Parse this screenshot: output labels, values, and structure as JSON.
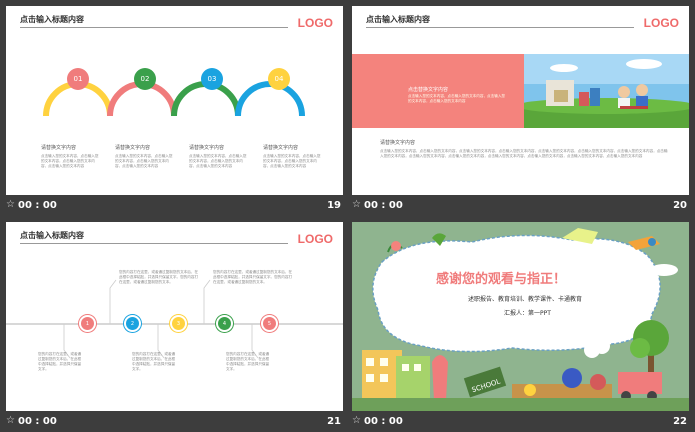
{
  "slides": [
    {
      "title": "点击输入标题内容",
      "logo": "LOGO",
      "steps": [
        {
          "num": "01",
          "color": "#f07c7c",
          "arc": "#ffd23f",
          "heading": "请替换文字内容",
          "text": "点击输入您的文本内容，点击输入您的文本内容，点击输入您的文本内容，点击输入您的文本内容"
        },
        {
          "num": "02",
          "color": "#3aa04b",
          "arc": "#f07c7c",
          "heading": "请替换文字内容",
          "text": "点击输入您的文本内容，点击输入您的文本内容，点击输入您的文本内容，点击输入您的文本内容"
        },
        {
          "num": "03",
          "color": "#1aa3e0",
          "arc": "#3aa04b",
          "heading": "请替换文字内容",
          "text": "点击输入您的文本内容，点击输入您的文本内容，点击输入您的文本内容，点击输入您的文本内容"
        },
        {
          "num": "04",
          "color": "#ffd23f",
          "arc": "#1aa3e0",
          "heading": "请替换文字内容",
          "text": "点击输入您的文本内容，点击输入您的文本内容，点击输入您的文本内容，点击输入您的文本内容"
        }
      ],
      "footer": {
        "time": "00 : 00",
        "num": "19"
      }
    },
    {
      "title": "点击输入标题内容",
      "logo": "LOGO",
      "banner_heading": "点击替换文字内容",
      "banner_text": "点击输入您的文本内容，点击输入您的文本内容，点击输入您的文本内容，点击输入您的文本内容",
      "body_heading": "请替换文字内容",
      "body_text": "点击输入您的文本内容，点击输入您的文本内容，点击输入您的文本内容，点击输入您的文本内容，点击输入您的文本内容，点击输入您的文本内容，点击输入您的文本内容，点击输入您的文本内容，点击输入您的文本内容，点击输入您的文本内容，点击输入您的文本内容，点击输入您的文本内容，点击输入您的文本内容，点击输入您的文本内容",
      "footer": {
        "time": "00 : 00",
        "num": "20"
      }
    },
    {
      "title": "点击输入标题内容",
      "logo": "LOGO",
      "nodes": [
        {
          "num": "1",
          "color": "#f07c7c"
        },
        {
          "num": "2",
          "color": "#1aa3e0"
        },
        {
          "num": "3",
          "color": "#ffd23f"
        },
        {
          "num": "4",
          "color": "#3aa04b"
        },
        {
          "num": "5",
          "color": "#f07c7c"
        }
      ],
      "top_text_1": "您的内容打在这里，或者通过复制您的文本后，在此框中选择粘贴，并选择只保留文字。您的内容打在这里，或者通过复制您的文本。",
      "top_text_2": "您的内容打在这里，或者通过复制您的文本后，在此框中选择粘贴，并选择只保留文字。您的内容打在这里，或者通过复制您的文本。",
      "bottom_text_1": "您的内容打在这里，或者通过复制您的文本后，在此框中选择粘贴，并选择只保留文字。",
      "bottom_text_2": "您的内容打在这里，或者通过复制您的文本后，在此框中选择粘贴，并选择只保留文字。",
      "bottom_text_3": "您的内容打在这里，或者通过复制您的文本后，在此框中选择粘贴，并选择只保留文字。",
      "footer": {
        "time": "00 : 00",
        "num": "21"
      }
    },
    {
      "heading": "感谢您的观看与指正！",
      "subheading": "述职报告、教育培训、教学课件、卡通教育",
      "reporter": "汇报人：第一PPT",
      "sign": "SCHOOL",
      "footer": {
        "time": "00 : 00",
        "num": "22"
      }
    }
  ],
  "colors": {
    "accent": "#ef6a6a",
    "green": "#3aa04b",
    "blue": "#1aa3e0",
    "yellow": "#ffd23f",
    "background": "#3d3d3d"
  }
}
